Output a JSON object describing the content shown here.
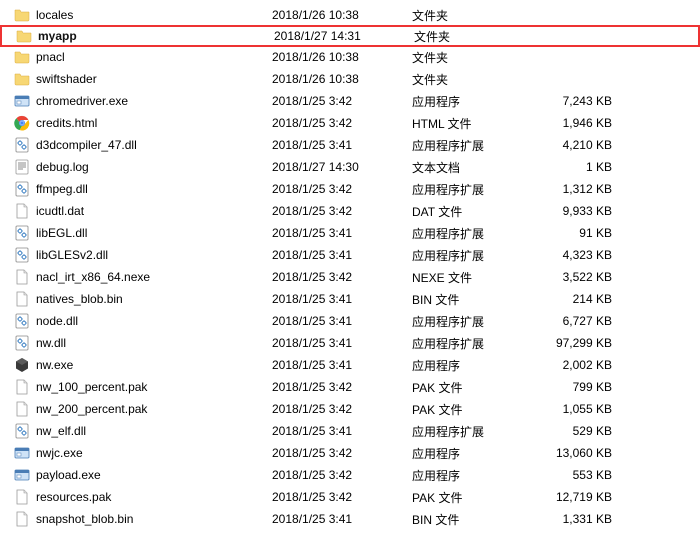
{
  "files": [
    {
      "icon": "folder",
      "name": "locales",
      "date": "2018/1/26 10:38",
      "type": "文件夹",
      "size": "",
      "highlighted": false
    },
    {
      "icon": "folder",
      "name": "myapp",
      "date": "2018/1/27 14:31",
      "type": "文件夹",
      "size": "",
      "highlighted": true
    },
    {
      "icon": "folder",
      "name": "pnacl",
      "date": "2018/1/26 10:38",
      "type": "文件夹",
      "size": "",
      "highlighted": false
    },
    {
      "icon": "folder",
      "name": "swiftshader",
      "date": "2018/1/26 10:38",
      "type": "文件夹",
      "size": "",
      "highlighted": false
    },
    {
      "icon": "exe",
      "name": "chromedriver.exe",
      "date": "2018/1/25 3:42",
      "type": "应用程序",
      "size": "7,243 KB",
      "highlighted": false
    },
    {
      "icon": "chrome",
      "name": "credits.html",
      "date": "2018/1/25 3:42",
      "type": "HTML 文件",
      "size": "1,946 KB",
      "highlighted": false
    },
    {
      "icon": "dll",
      "name": "d3dcompiler_47.dll",
      "date": "2018/1/25 3:41",
      "type": "应用程序扩展",
      "size": "4,210 KB",
      "highlighted": false
    },
    {
      "icon": "text",
      "name": "debug.log",
      "date": "2018/1/27 14:30",
      "type": "文本文档",
      "size": "1 KB",
      "highlighted": false
    },
    {
      "icon": "dll",
      "name": "ffmpeg.dll",
      "date": "2018/1/25 3:42",
      "type": "应用程序扩展",
      "size": "1,312 KB",
      "highlighted": false
    },
    {
      "icon": "file",
      "name": "icudtl.dat",
      "date": "2018/1/25 3:42",
      "type": "DAT 文件",
      "size": "9,933 KB",
      "highlighted": false
    },
    {
      "icon": "dll",
      "name": "libEGL.dll",
      "date": "2018/1/25 3:41",
      "type": "应用程序扩展",
      "size": "91 KB",
      "highlighted": false
    },
    {
      "icon": "dll",
      "name": "libGLESv2.dll",
      "date": "2018/1/25 3:41",
      "type": "应用程序扩展",
      "size": "4,323 KB",
      "highlighted": false
    },
    {
      "icon": "file",
      "name": "nacl_irt_x86_64.nexe",
      "date": "2018/1/25 3:42",
      "type": "NEXE 文件",
      "size": "3,522 KB",
      "highlighted": false
    },
    {
      "icon": "file",
      "name": "natives_blob.bin",
      "date": "2018/1/25 3:41",
      "type": "BIN 文件",
      "size": "214 KB",
      "highlighted": false
    },
    {
      "icon": "dll",
      "name": "node.dll",
      "date": "2018/1/25 3:41",
      "type": "应用程序扩展",
      "size": "6,727 KB",
      "highlighted": false
    },
    {
      "icon": "dll",
      "name": "nw.dll",
      "date": "2018/1/25 3:41",
      "type": "应用程序扩展",
      "size": "97,299 KB",
      "highlighted": false
    },
    {
      "icon": "nw",
      "name": "nw.exe",
      "date": "2018/1/25 3:41",
      "type": "应用程序",
      "size": "2,002 KB",
      "highlighted": false
    },
    {
      "icon": "file",
      "name": "nw_100_percent.pak",
      "date": "2018/1/25 3:42",
      "type": "PAK 文件",
      "size": "799 KB",
      "highlighted": false
    },
    {
      "icon": "file",
      "name": "nw_200_percent.pak",
      "date": "2018/1/25 3:42",
      "type": "PAK 文件",
      "size": "1,055 KB",
      "highlighted": false
    },
    {
      "icon": "dll",
      "name": "nw_elf.dll",
      "date": "2018/1/25 3:41",
      "type": "应用程序扩展",
      "size": "529 KB",
      "highlighted": false
    },
    {
      "icon": "exe",
      "name": "nwjc.exe",
      "date": "2018/1/25 3:42",
      "type": "应用程序",
      "size": "13,060 KB",
      "highlighted": false
    },
    {
      "icon": "exe",
      "name": "payload.exe",
      "date": "2018/1/25 3:42",
      "type": "应用程序",
      "size": "553 KB",
      "highlighted": false
    },
    {
      "icon": "file",
      "name": "resources.pak",
      "date": "2018/1/25 3:42",
      "type": "PAK 文件",
      "size": "12,719 KB",
      "highlighted": false
    },
    {
      "icon": "file",
      "name": "snapshot_blob.bin",
      "date": "2018/1/25 3:41",
      "type": "BIN 文件",
      "size": "1,331 KB",
      "highlighted": false
    }
  ]
}
